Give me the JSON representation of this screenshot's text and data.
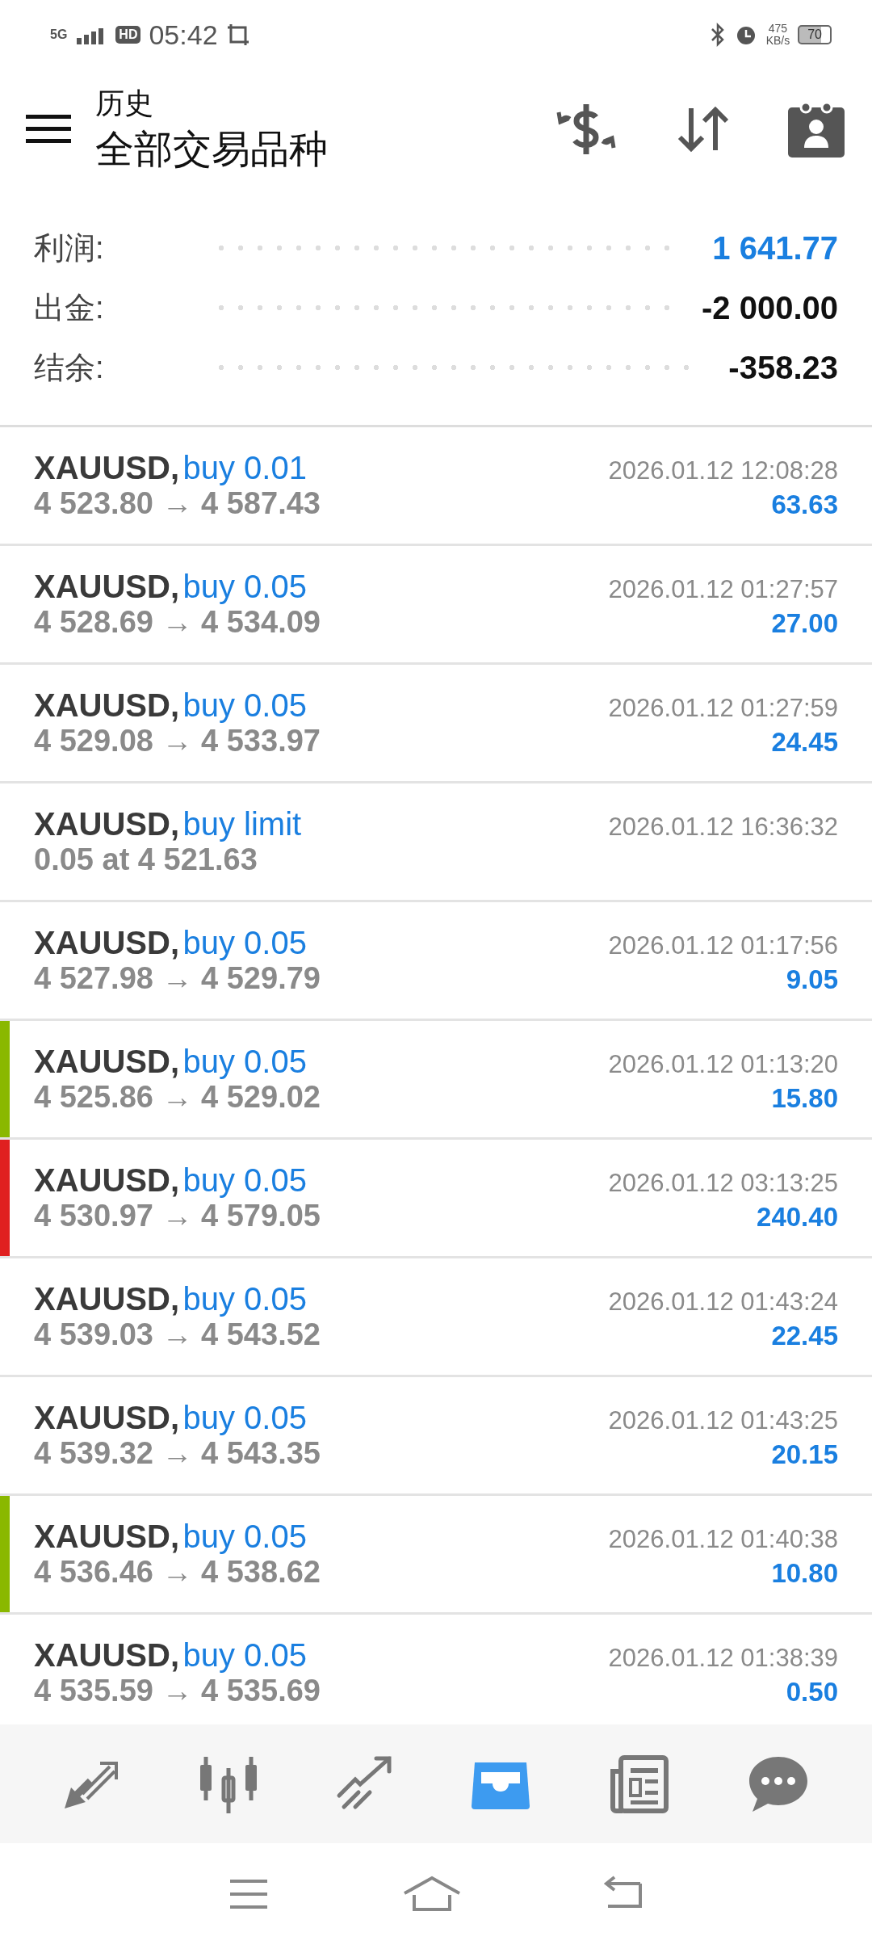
{
  "status_bar": {
    "network": "5G",
    "hd": "HD",
    "time": "05:42",
    "speed": "475",
    "speed_unit": "KB/s",
    "battery": "70"
  },
  "header": {
    "subtitle": "历史",
    "title": "全部交易品种"
  },
  "summary": [
    {
      "label": "利润:",
      "value": "1 641.77",
      "kind": "profit"
    },
    {
      "label": "出金:",
      "value": "-2 000.00",
      "kind": "plain"
    },
    {
      "label": "结余:",
      "value": "-358.23",
      "kind": "plain"
    }
  ],
  "deals": [
    {
      "kind": "deal",
      "symbol": "XAUUSD,",
      "type": "buy 0.01",
      "detail": "4 523.80 → 4 587.43",
      "time": "2026.01.12 12:08:28",
      "profit": "63.63"
    },
    {
      "kind": "deal",
      "symbol": "XAUUSD,",
      "type": "buy 0.05",
      "detail": "4 528.69 → 4 534.09",
      "time": "2026.01.12 01:27:57",
      "profit": "27.00"
    },
    {
      "kind": "deal",
      "symbol": "XAUUSD,",
      "type": "buy 0.05",
      "detail": "4 529.08 → 4 533.97",
      "time": "2026.01.12 01:27:59",
      "profit": "24.45"
    },
    {
      "kind": "order",
      "symbol": "XAUUSD,",
      "type": "buy limit",
      "detail": "0.05 at 4 521.63",
      "time": "2026.01.12 16:36:32"
    },
    {
      "kind": "deal",
      "symbol": "XAUUSD,",
      "type": "buy 0.05",
      "detail": "4 527.98 → 4 529.79",
      "time": "2026.01.12 01:17:56",
      "profit": "9.05"
    },
    {
      "kind": "deal",
      "symbol": "XAUUSD,",
      "type": "buy 0.05",
      "detail": "4 525.86 → 4 529.02",
      "time": "2026.01.12 01:13:20",
      "profit": "15.80",
      "color": "#8ab800"
    },
    {
      "kind": "deal",
      "symbol": "XAUUSD,",
      "type": "buy 0.05",
      "detail": "4 530.97 → 4 579.05",
      "time": "2026.01.12 03:13:25",
      "profit": "240.40",
      "color": "#e02020"
    },
    {
      "kind": "deal",
      "symbol": "XAUUSD,",
      "type": "buy 0.05",
      "detail": "4 539.03 → 4 543.52",
      "time": "2026.01.12 01:43:24",
      "profit": "22.45"
    },
    {
      "kind": "deal",
      "symbol": "XAUUSD,",
      "type": "buy 0.05",
      "detail": "4 539.32 → 4 543.35",
      "time": "2026.01.12 01:43:25",
      "profit": "20.15"
    },
    {
      "kind": "deal",
      "symbol": "XAUUSD,",
      "type": "buy 0.05",
      "detail": "4 536.46 → 4 538.62",
      "time": "2026.01.12 01:40:38",
      "profit": "10.80",
      "color": "#8ab800"
    },
    {
      "kind": "deal",
      "symbol": "XAUUSD,",
      "type": "buy 0.05",
      "detail": "4 535.59 → 4 535.69",
      "time": "2026.01.12 01:38:39",
      "profit": "0.50"
    }
  ],
  "tab_bar": [
    {
      "kind": "quotes",
      "selected": false
    },
    {
      "kind": "chart",
      "selected": false
    },
    {
      "kind": "trade",
      "selected": false
    },
    {
      "kind": "history",
      "selected": true
    },
    {
      "kind": "news",
      "selected": false
    },
    {
      "kind": "chat",
      "selected": false
    }
  ]
}
